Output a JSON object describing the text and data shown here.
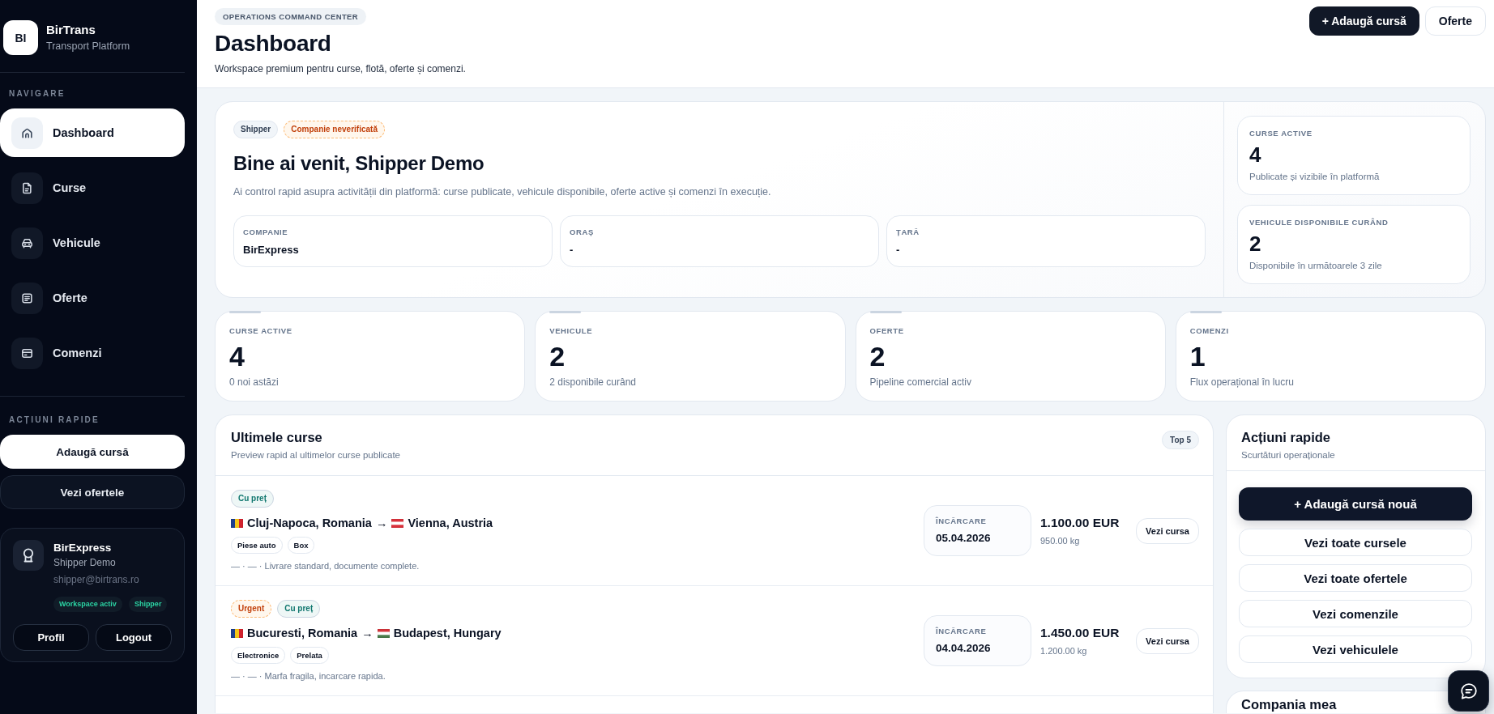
{
  "sidebar": {
    "logo": {
      "initials": "BI",
      "title": "BirTrans",
      "subtitle": "Transport Platform"
    },
    "nav_heading": "NAVIGARE",
    "nav_items": [
      {
        "label": "Dashboard",
        "selected": true
      },
      {
        "label": "Curse",
        "selected": false
      },
      {
        "label": "Vehicule",
        "selected": false
      },
      {
        "label": "Oferte",
        "selected": false
      },
      {
        "label": "Comenzi",
        "selected": false
      }
    ],
    "actions_heading": "ACȚIUNI RAPIDE",
    "actions": [
      {
        "label": "Adaugă cursă",
        "kind": "primary"
      },
      {
        "label": "Vezi ofertele",
        "kind": "secondary"
      }
    ],
    "profile": {
      "company": "BirExpress",
      "name": "Shipper Demo",
      "email": "shipper@birtrans.ro",
      "badges": [
        "Workspace activ",
        "Shipper"
      ],
      "buttons": [
        "Profil",
        "Logout"
      ]
    }
  },
  "header": {
    "eyebrow": "OPERATIONS COMMAND CENTER",
    "title": "Dashboard",
    "subtitle": "Workspace premium pentru curse, flotă, oferte și comenzi.",
    "buttons": [
      {
        "label": "+ Adaugă cursă",
        "kind": "primary"
      },
      {
        "label": "Oferte",
        "kind": "secondary"
      }
    ]
  },
  "welcome": {
    "badges": [
      {
        "label": "Shipper",
        "kind": "neutral"
      },
      {
        "label": "Companie neverificată",
        "kind": "warning"
      }
    ],
    "title": "Bine ai venit, Shipper Demo",
    "text": "Ai control rapid asupra activității din platformă: curse publicate, vehicule disponibile, oferte active și comenzi în execuție.",
    "fields": [
      {
        "label": "COMPANIE",
        "value": "BirExpress"
      },
      {
        "label": "ORAȘ",
        "value": "-"
      },
      {
        "label": "ȚARĂ",
        "value": "-"
      }
    ],
    "highlights": [
      {
        "label": "CURSE ACTIVE",
        "value": "4",
        "note": "Publicate și vizibile în platformă"
      },
      {
        "label": "VEHICULE DISPONIBILE CURÂND",
        "value": "2",
        "note": "Disponibile în următoarele 3 zile"
      }
    ]
  },
  "stats": [
    {
      "label": "CURSE ACTIVE",
      "value": "4",
      "note": "0 noi astăzi"
    },
    {
      "label": "VEHICULE",
      "value": "2",
      "note": "2 disponibile curând"
    },
    {
      "label": "OFERTE",
      "value": "2",
      "note": "Pipeline comercial activ"
    },
    {
      "label": "COMENZI",
      "value": "1",
      "note": "Flux operațional în lucru"
    }
  ],
  "latest_routes": {
    "title": "Ultimele curse",
    "subtitle": "Preview rapid al ultimelor curse publicate",
    "badge": "Top 5",
    "rows": [
      {
        "badges": [
          {
            "label": "Cu preț",
            "kind": "success"
          }
        ],
        "origin": "Cluj-Napoca, Romania",
        "arrow": "→",
        "destination": "Vienna, Austria",
        "tags": [
          "Piese auto",
          "Box"
        ],
        "note": "— · — · Livrare standard, documente complete.",
        "loading_label": "ÎNCĂRCARE",
        "loading_date": "05.04.2026",
        "price": "1.100.00 EUR",
        "weight": "950.00 kg",
        "button": "Vezi cursa"
      },
      {
        "badges": [
          {
            "label": "Urgent",
            "kind": "warning"
          },
          {
            "label": "Cu preț",
            "kind": "success"
          }
        ],
        "origin": "Bucuresti, Romania",
        "arrow": "→",
        "destination": "Budapest, Hungary",
        "tags": [
          "Electronice",
          "Prelata"
        ],
        "note": "— · — · Marfa fragila, incarcare rapida.",
        "loading_label": "ÎNCĂRCARE",
        "loading_date": "04.04.2026",
        "price": "1.450.00 EUR",
        "weight": "1.200.00 kg",
        "button": "Vezi cursa"
      }
    ]
  },
  "quick_actions": {
    "title": "Acțiuni rapide",
    "subtitle": "Scurtături operaționale",
    "buttons": [
      {
        "label": "+ Adaugă cursă nouă",
        "kind": "primary"
      },
      {
        "label": "Vezi toate cursele",
        "kind": "secondary"
      },
      {
        "label": "Vezi toate ofertele",
        "kind": "secondary"
      },
      {
        "label": "Vezi comenzile",
        "kind": "secondary"
      },
      {
        "label": "Vezi vehiculele",
        "kind": "secondary"
      }
    ]
  },
  "company_card": {
    "title": "Compania mea"
  }
}
